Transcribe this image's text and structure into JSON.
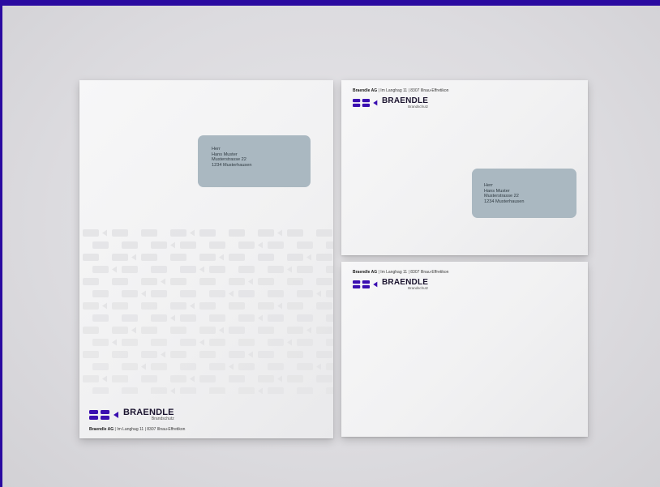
{
  "brand": {
    "name": "BRAENDLE",
    "tagline": "Brandschutz",
    "color": "#3a0fb0"
  },
  "sender": {
    "company": "Braendle AG",
    "separator": " | ",
    "street": "Im Langhag 11",
    "city": "8307 Illnau-Effretikon"
  },
  "recipient": {
    "salutation": "Herr",
    "name": "Hans Muster",
    "street": "Musterstrasse 22",
    "city": "1234 Musterhausen"
  },
  "colors": {
    "background": "#2a0aa0",
    "address_window": "#aab8c1"
  }
}
